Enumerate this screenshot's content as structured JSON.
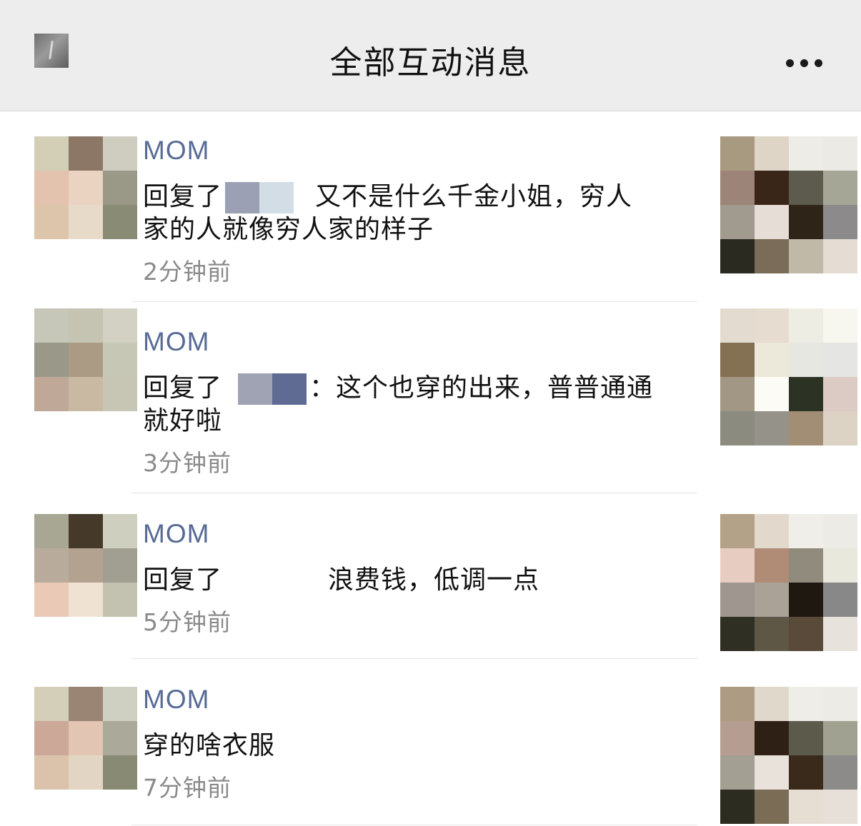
{
  "header": {
    "title": "全部互动消息",
    "back_icon": "pixelated-thumbnail-icon",
    "more_icon": "more-dots-icon"
  },
  "colors": {
    "nav_bg": "#ededed",
    "name": "#576b95",
    "text": "#111111",
    "time": "#8a8a8a"
  },
  "messages": [
    {
      "name": "MOM",
      "prefix": "回复了",
      "line1_rest": "又不是什么千金小姐，穷人",
      "line2": "家的人就像穷人家的样子",
      "time": "2分钟前"
    },
    {
      "name": "MOM",
      "prefix": "回复了",
      "line1_rest": "：这个也穿的出来，普普通通",
      "line2": "就好啦",
      "time": "3分钟前"
    },
    {
      "name": "MOM",
      "prefix": "回复了",
      "line1_rest": "浪费钱，低调一点",
      "time": "5分钟前"
    },
    {
      "name": "MOM",
      "text": "穿的啥衣服",
      "time": "7分钟前"
    }
  ]
}
